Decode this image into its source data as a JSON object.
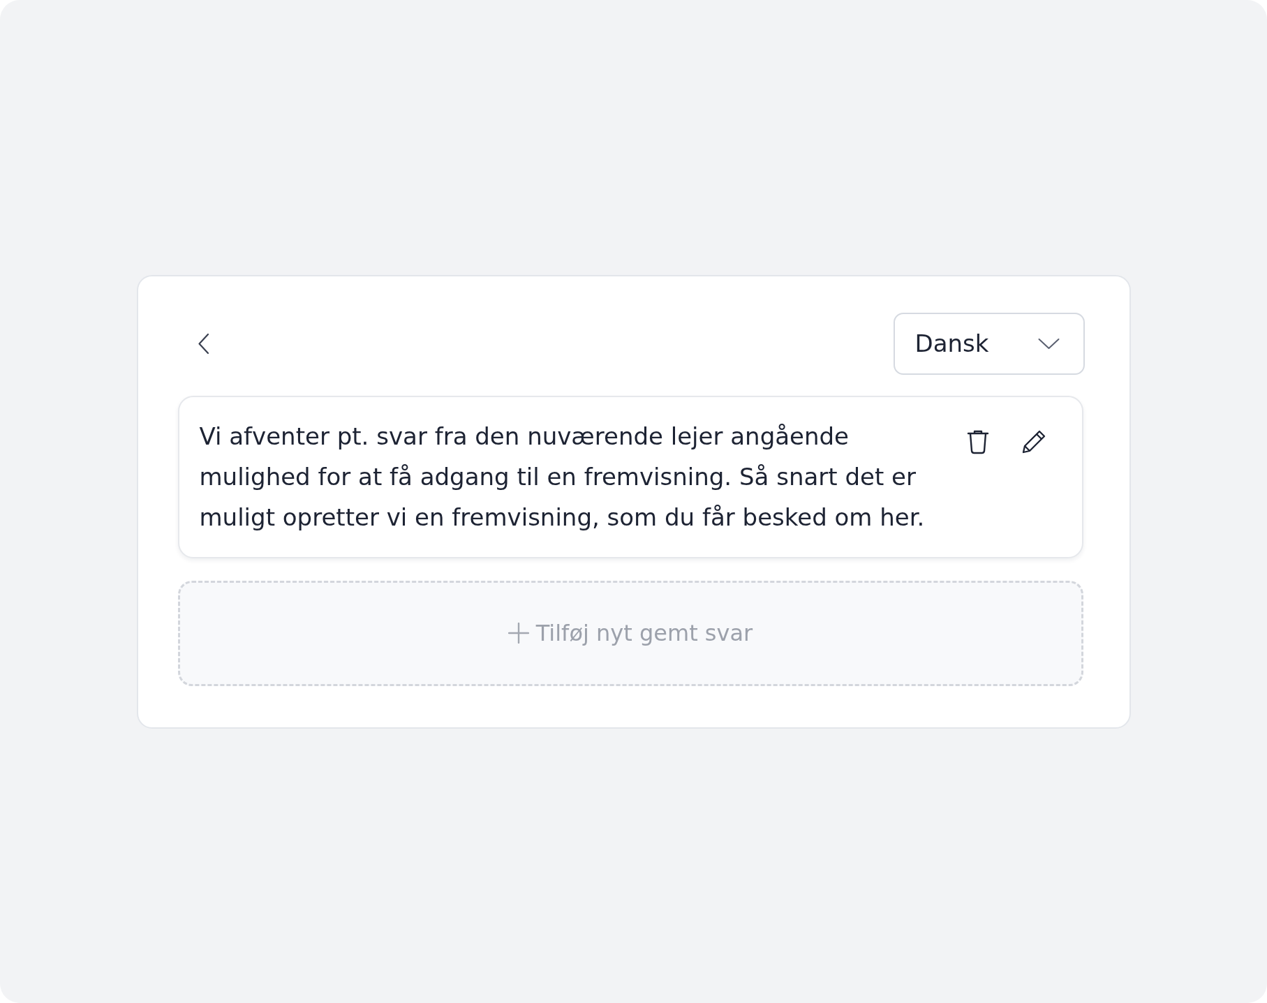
{
  "language_select": {
    "value": "Dansk"
  },
  "saved_replies": [
    {
      "text": "Vi afventer pt. svar fra den nuværende lejer angående mulighed for at få adgang til en fremvisning. Så snart det er muligt opretter vi en fremvisning, som du får besked om her."
    }
  ],
  "add_button": {
    "label": "Tilføj nyt gemt svar"
  }
}
